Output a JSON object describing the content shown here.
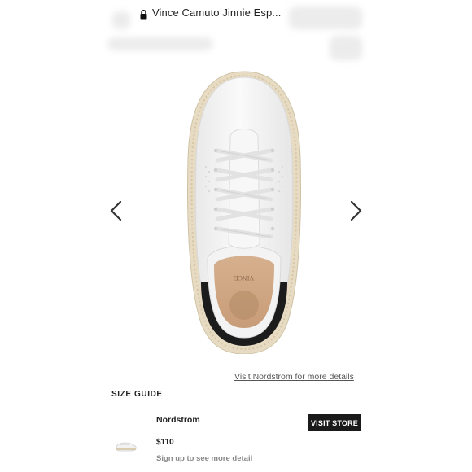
{
  "header": {
    "title": "Vince Camuto Jinnie Esp...",
    "lock_icon": "lock-icon"
  },
  "gallery": {
    "prev_icon": "chevron-left-icon",
    "next_icon": "chevron-right-icon",
    "image_name": "product-image"
  },
  "links": {
    "details": "Visit Nordstrom for more details",
    "size_guide": "SIZE GUIDE"
  },
  "store": {
    "name": "Nordstrom",
    "visit_label": "VISIT STORE",
    "price": "$110",
    "signup": "Sign up to see more detail"
  },
  "colors": {
    "button_bg": "#1a1a1a",
    "link": "#555555",
    "muted": "#8a8a8a"
  }
}
